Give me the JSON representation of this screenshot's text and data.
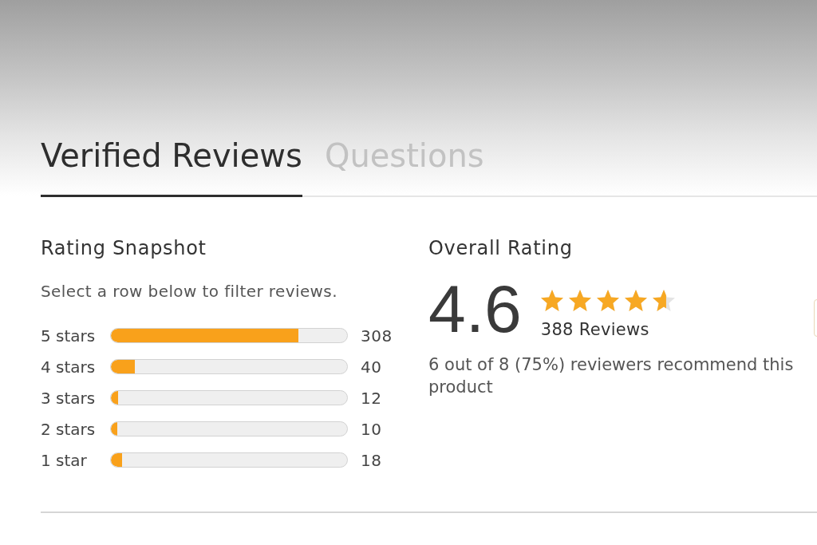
{
  "tabs": [
    {
      "label": "Verified Reviews",
      "selected": true
    },
    {
      "label": "Questions",
      "selected": false
    }
  ],
  "rating_snapshot": {
    "title": "Rating Snapshot",
    "hint": "Select a row below to filter reviews.",
    "rows": [
      {
        "label": "5 stars",
        "level": 0.794,
        "count": "308"
      },
      {
        "label": "4 stars",
        "level": 0.103,
        "count": "40"
      },
      {
        "label": "3 stars",
        "level": 0.031,
        "count": "12"
      },
      {
        "label": "2 stars",
        "level": 0.026,
        "count": "10"
      },
      {
        "label": "1 star",
        "level": 0.046,
        "count": "18"
      }
    ]
  },
  "overall_rating": {
    "title": "Overall Rating",
    "score": "4.6",
    "stars": 4.6,
    "reviews": "388 Reviews",
    "recommend": "6 out of 8 (75%) reviewers recommend this product"
  }
}
